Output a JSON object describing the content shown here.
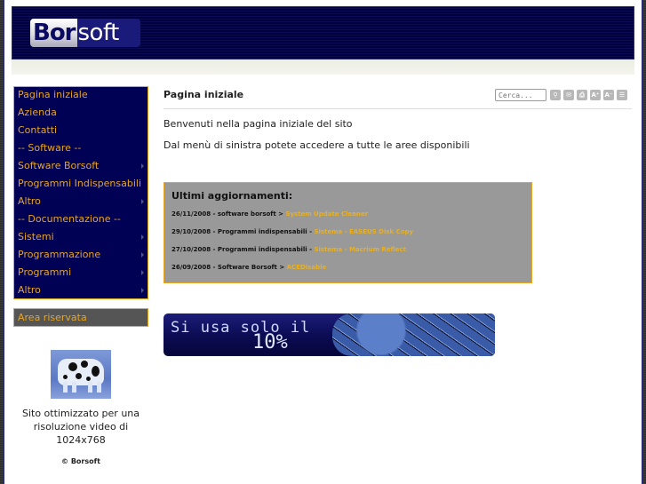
{
  "header": {
    "logo_part1": "Bor",
    "logo_part2": "soft"
  },
  "sidebar": {
    "menu": [
      {
        "label": "Pagina iniziale",
        "has_submenu": false
      },
      {
        "label": "Azienda",
        "has_submenu": false
      },
      {
        "label": "Contatti",
        "has_submenu": false
      },
      {
        "label": "-- Software --",
        "has_submenu": false
      },
      {
        "label": "Software Borsoft",
        "has_submenu": true
      },
      {
        "label": "Programmi Indispensabili",
        "has_submenu": false
      },
      {
        "label": "Altro",
        "has_submenu": true
      },
      {
        "label": "-- Documentazione --",
        "has_submenu": false
      },
      {
        "label": "Sistemi",
        "has_submenu": true
      },
      {
        "label": "Programmazione",
        "has_submenu": true
      },
      {
        "label": "Programmi",
        "has_submenu": true
      },
      {
        "label": "Altro",
        "has_submenu": true
      }
    ],
    "reserved_area": "Area riservata",
    "optimized_text": "Sito ottimizzato per una risoluzione video di 1024x768",
    "copyright": "© Borsoft"
  },
  "main": {
    "title": "Pagina iniziale",
    "search_placeholder": "Cerca...",
    "tools": [
      {
        "icon": "search-icon",
        "glyph": "⚲"
      },
      {
        "icon": "email-icon",
        "glyph": "✉"
      },
      {
        "icon": "print-icon",
        "glyph": "⎙"
      },
      {
        "icon": "font-increase-icon",
        "glyph": "A⁺"
      },
      {
        "icon": "font-decrease-icon",
        "glyph": "A⁻"
      },
      {
        "icon": "sitemap-icon",
        "glyph": "☰"
      }
    ],
    "paragraphs": [
      "Benvenuti nella pagina iniziale del sito",
      "Dal menù di sinistra potete accedere a tutte le aree disponibili"
    ],
    "updates": {
      "heading": "Ultimi aggiornamenti:",
      "items": [
        {
          "prefix": "26/11/2008 - software borsoft > ",
          "link": "System Update Cleaner"
        },
        {
          "prefix": "29/10/2008 - Programmi indispensabili - ",
          "link": "Sistema - EASEUS Disk Copy"
        },
        {
          "prefix": "27/10/2008 - Programmi indispensabili - ",
          "link": "Sistema - Macrium Reflect"
        },
        {
          "prefix": "26/09/2008 - Software Borsoft > ",
          "link": "ACEDisable"
        }
      ]
    },
    "banner": {
      "line1": "Si usa solo il",
      "line2": "10%"
    }
  },
  "colors": {
    "accent": "#e6a624",
    "menu_bg": "#000055",
    "header_bg": "#000040",
    "updates_bg": "#999999"
  }
}
